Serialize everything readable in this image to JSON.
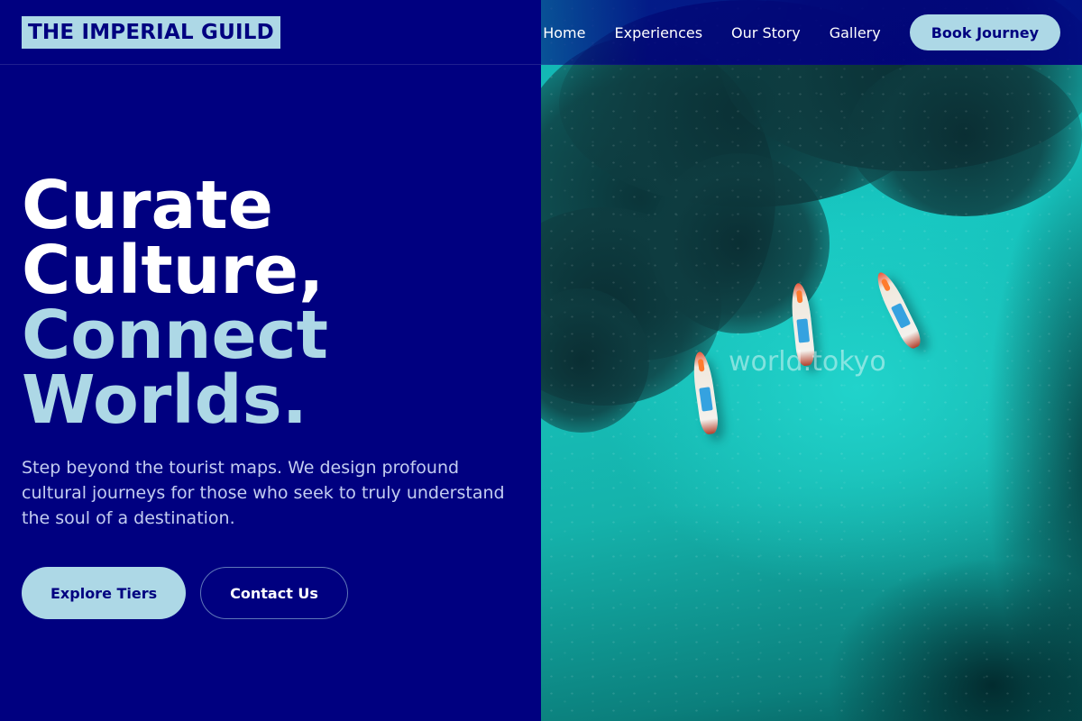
{
  "brand": {
    "name": "THE IMPERIAL GUILD"
  },
  "nav": {
    "links": [
      "Home",
      "Experiences",
      "Our Story",
      "Gallery"
    ],
    "cta_label": "Book Journey"
  },
  "hero": {
    "title_lines": [
      "Curate",
      "Culture,"
    ],
    "title_accent_lines": [
      "Connect",
      "Worlds."
    ],
    "subtitle": "Step beyond the tourist maps. We design profound cultural journeys for those who seek to truly understand the soul of a destination.",
    "primary_button": "Explore Tiers",
    "secondary_button": "Contact Us"
  },
  "image": {
    "watermark": "world.tokyo",
    "description_icon": "aerial-ocean-boats-image"
  },
  "colors": {
    "background": "#000080",
    "accent": "#add8e6",
    "text": "#ffffff",
    "subtext": "#c3cdf0"
  }
}
